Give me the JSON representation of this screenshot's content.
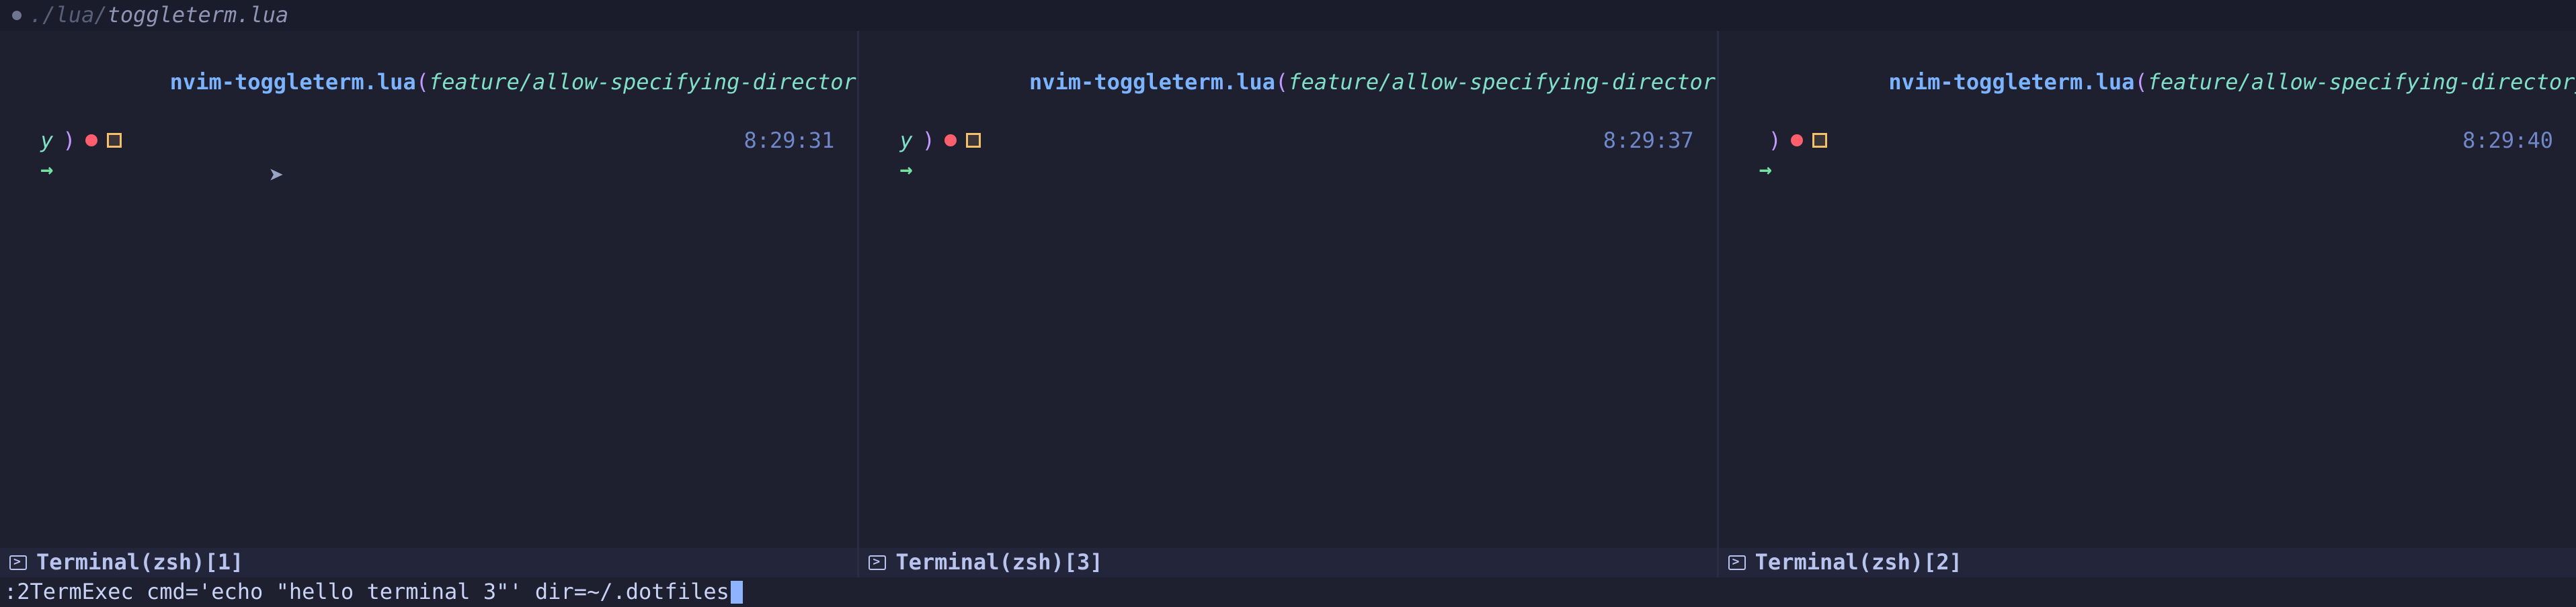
{
  "titlebar": {
    "path_prefix": "./lua/",
    "path_file": "toggleterm.lua"
  },
  "panes": [
    {
      "dir": "nvim-toggleterm.lua",
      "branch_head": "feature/allow-specifying-director",
      "branch_tail": "y",
      "time": "8:29:31",
      "arrow": "→",
      "status_label": "Terminal(zsh)[1]",
      "has_pointer": true
    },
    {
      "dir": "nvim-toggleterm.lua",
      "branch_head": "feature/allow-specifying-director",
      "branch_tail": "y",
      "time": "8:29:37",
      "arrow": "→",
      "status_label": "Terminal(zsh)[3]",
      "has_pointer": false
    },
    {
      "dir": "nvim-toggleterm.lua",
      "branch_head": "feature/allow-specifying-directory",
      "branch_tail": "",
      "time": "8:29:40",
      "arrow": "→",
      "status_label": "Terminal(zsh)[2]",
      "has_pointer": false
    }
  ],
  "cmdline": {
    "text": ":2TermExec cmd='echo \"hello terminal 3\"' dir=~/.dotfiles"
  },
  "icons": {
    "terminal": "terminal-icon",
    "pointer": "➤"
  },
  "colors": {
    "bg": "#1e2030",
    "dir": "#7cb3ff",
    "branch": "#7fe0c7",
    "paren": "#c199ff",
    "time": "#7088c9",
    "arrow": "#78e0a0",
    "status_bg": "#23263b",
    "cursor": "#8fb4ff"
  }
}
